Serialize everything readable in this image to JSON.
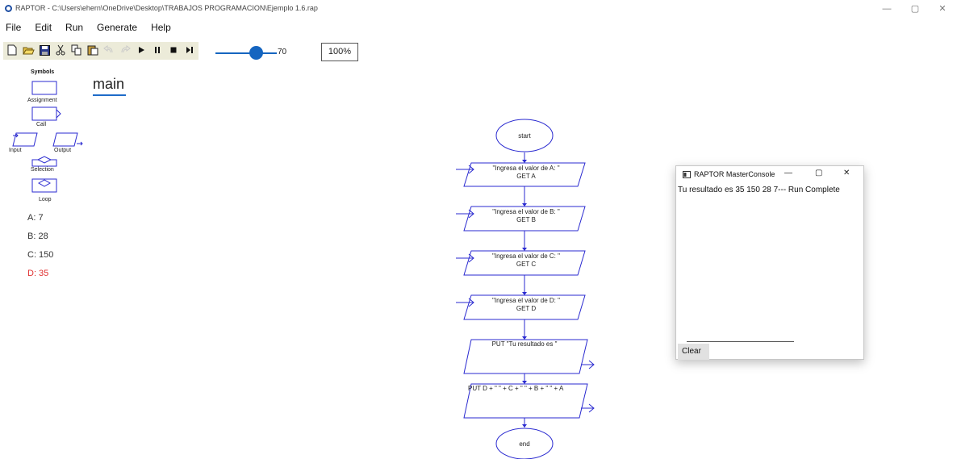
{
  "window": {
    "title": "RAPTOR - C:\\Users\\ehern\\OneDrive\\Desktop\\TRABAJOS PROGRAMACION\\Ejemplo 1.6.rap",
    "minimize": "—",
    "restore": "▢",
    "close": "✕"
  },
  "menu": [
    "File",
    "Edit",
    "Run",
    "Generate",
    "Help"
  ],
  "toolbar": {
    "icons": [
      "new-file-icon",
      "open-folder-icon",
      "save-icon",
      "cut-icon",
      "copy-icon",
      "paste-icon",
      "undo-icon",
      "redo-icon",
      "play-icon",
      "pause-icon",
      "stop-icon",
      "step-icon"
    ]
  },
  "speed": {
    "value": "70",
    "level": 70
  },
  "zoom": {
    "value": "100%"
  },
  "symbols": {
    "title": "Symbols",
    "assignment": "Assignment",
    "call": "Call",
    "input": "Input",
    "output": "Output",
    "selection": "Selection",
    "loop": "Loop"
  },
  "variables": [
    {
      "text": "A: 7",
      "highlight": false
    },
    {
      "text": "B: 28",
      "highlight": false
    },
    {
      "text": "C: 150",
      "highlight": false
    },
    {
      "text": "D: 35",
      "highlight": true
    }
  ],
  "tab": {
    "label": "main"
  },
  "flow": {
    "start": "start",
    "inputA_prompt": "\"Ingresa el valor de A: \"",
    "inputA_get": "GET A",
    "inputB_prompt": "\"Ingresa el valor de B: \"",
    "inputB_get": "GET B",
    "inputC_prompt": "\"Ingresa el valor de C: \"",
    "inputC_get": "GET C",
    "inputD_prompt": "\"Ingresa el valor de D: \"",
    "inputD_get": "GET D",
    "output1": "PUT \"Tu resultado es \"",
    "output2": "PUT D + \" \" + C + \" \" + B + \" \" + A",
    "end": "end"
  },
  "console": {
    "title": "RAPTOR MasterConsole",
    "minimize": "—",
    "restore": "▢",
    "close": "✕",
    "output": "Tu resultado es 35 150 28 7--- Run Complete",
    "clear_label": "Clear"
  },
  "colors": {
    "flow_stroke": "#2a2ad0",
    "accent": "#1565c0",
    "highlight": "#e03030"
  }
}
